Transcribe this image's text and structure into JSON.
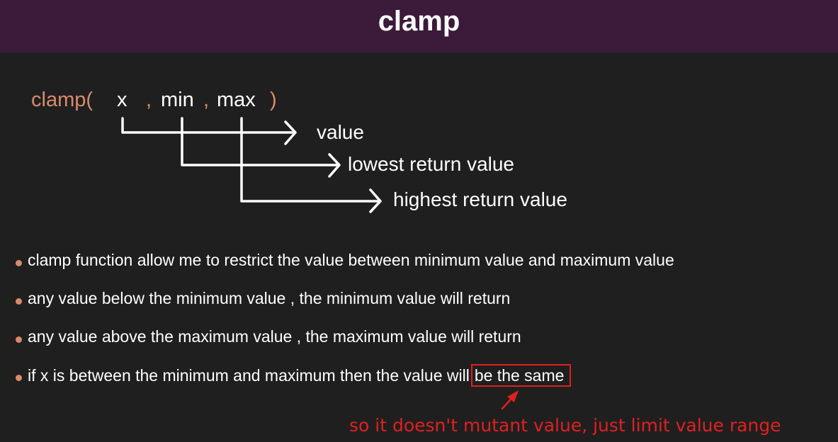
{
  "title": "clamp",
  "signature": {
    "func": "clamp(",
    "x": "x",
    "comma1": ",",
    "min": "min",
    "comma2": ",",
    "max": "max",
    "close": ")"
  },
  "labels": {
    "x": "value",
    "min": "lowest return value",
    "max": "highest return value"
  },
  "bullets": [
    "clamp function allow me to restrict the value between minimum value and maximum value",
    "any value below the minimum value , the minimum value will return",
    "any value above the maximum value , the maximum value will return"
  ],
  "last_bullet": {
    "text": "if x is between the minimum and maximum then the value will",
    "highlight": "be the same"
  },
  "annotation": "so it doesn't mutant value, just limit value range",
  "colors": {
    "header": "#3b1a3a",
    "background": "#1f1f1f",
    "accent": "#d98c6a",
    "annotation": "#e02020"
  }
}
